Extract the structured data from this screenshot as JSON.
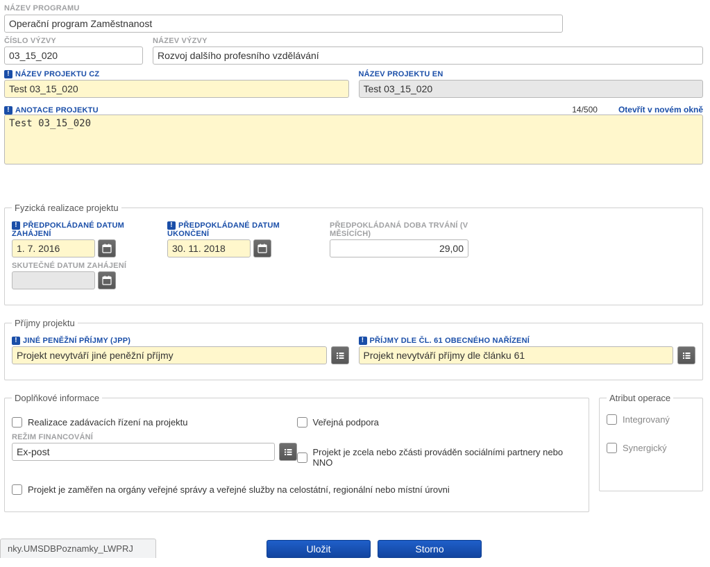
{
  "header": {
    "program_label": "NÁZEV PROGRAMU",
    "program_value": "Operační program Zaměstnanost",
    "call_number_label": "ČÍSLO VÝZVY",
    "call_number_value": "03_15_020",
    "call_name_label": "NÁZEV VÝZVY",
    "call_name_value": "Rozvoj dalšího profesního vzdělávání"
  },
  "project": {
    "name_cz_label": "NÁZEV PROJEKTU CZ",
    "name_cz_value": "Test 03_15_020",
    "name_en_label": "NÁZEV PROJEKTU EN",
    "name_en_value": "Test 03_15_020"
  },
  "annotation": {
    "label": "ANOTACE PROJEKTU",
    "value": "Test 03_15_020",
    "counter": "14/500",
    "open_link": "Otevřít v novém okně"
  },
  "realization": {
    "legend": "Fyzická realizace projektu",
    "planned_start_label": "PŘEDPOKLÁDANÉ DATUM ZAHÁJENÍ",
    "planned_start_value": "1. 7. 2016",
    "planned_end_label": "PŘEDPOKLÁDANÉ DATUM UKONČENÍ",
    "planned_end_value": "30. 11. 2018",
    "duration_label": "PŘEDPOKLÁDANÁ DOBA TRVÁNÍ (V MĚSÍCÍCH)",
    "duration_value": "29,00",
    "actual_start_label": "SKUTEČNÉ DATUM ZAHÁJENÍ",
    "actual_start_value": ""
  },
  "income": {
    "legend": "Příjmy projektu",
    "jpp_label": "JINÉ PENĚŽNÍ PŘÍJMY (JPP)",
    "jpp_value": "Projekt nevytváří jiné peněžní příjmy",
    "art61_label": "PŘÍJMY DLE ČL. 61 OBECNÉHO NAŘÍZENÍ",
    "art61_value": "Projekt nevytváří příjmy dle článku 61"
  },
  "extras": {
    "legend": "Doplňkové informace",
    "chk_tenders": "Realizace zadávacích řízení na projektu",
    "chk_public_support": "Veřejná podpora",
    "financing_mode_label": "REŽIM FINANCOVÁNÍ",
    "financing_mode_value": "Ex-post",
    "chk_social_partners": "Projekt je zcela nebo zčásti prováděn sociálními partnery nebo NNO",
    "chk_public_bodies": "Projekt je zaměřen na orgány veřejné správy a veřejné služby na celostátní, regionální nebo místní úrovni"
  },
  "attribute": {
    "legend": "Atribut operace",
    "chk_integrated": "Integrovaný",
    "chk_synergic": "Synergický"
  },
  "footer": {
    "tab_stub": "nky.UMSDBPoznamky_LWPRJ",
    "save": "Uložit",
    "cancel": "Storno"
  }
}
